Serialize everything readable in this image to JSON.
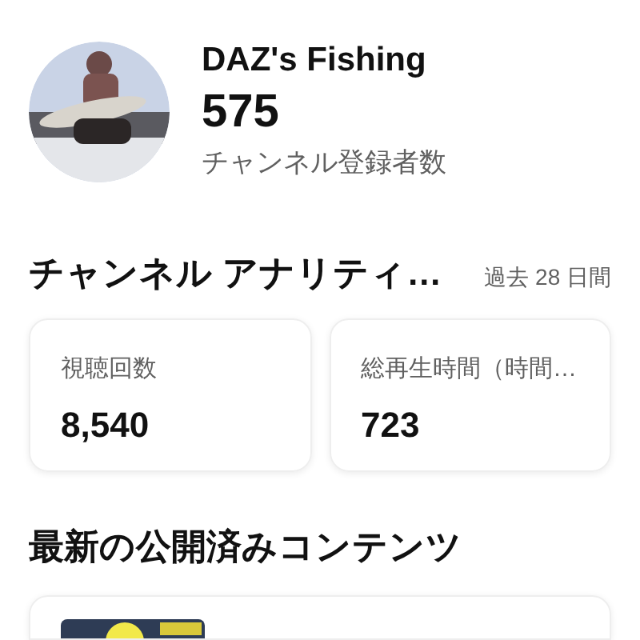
{
  "channel": {
    "name": "DAZ's Fishing",
    "subscribers": "575",
    "subscribers_label": "チャンネル登録者数"
  },
  "analytics": {
    "title": "チャンネル アナリティ…",
    "period": "過去 28 日間",
    "metrics": [
      {
        "label": "視聴回数",
        "value": "8,540"
      },
      {
        "label": "総再生時間（時間…",
        "value": "723"
      }
    ]
  },
  "latest": {
    "title": "最新の公開済みコンテンツ"
  }
}
